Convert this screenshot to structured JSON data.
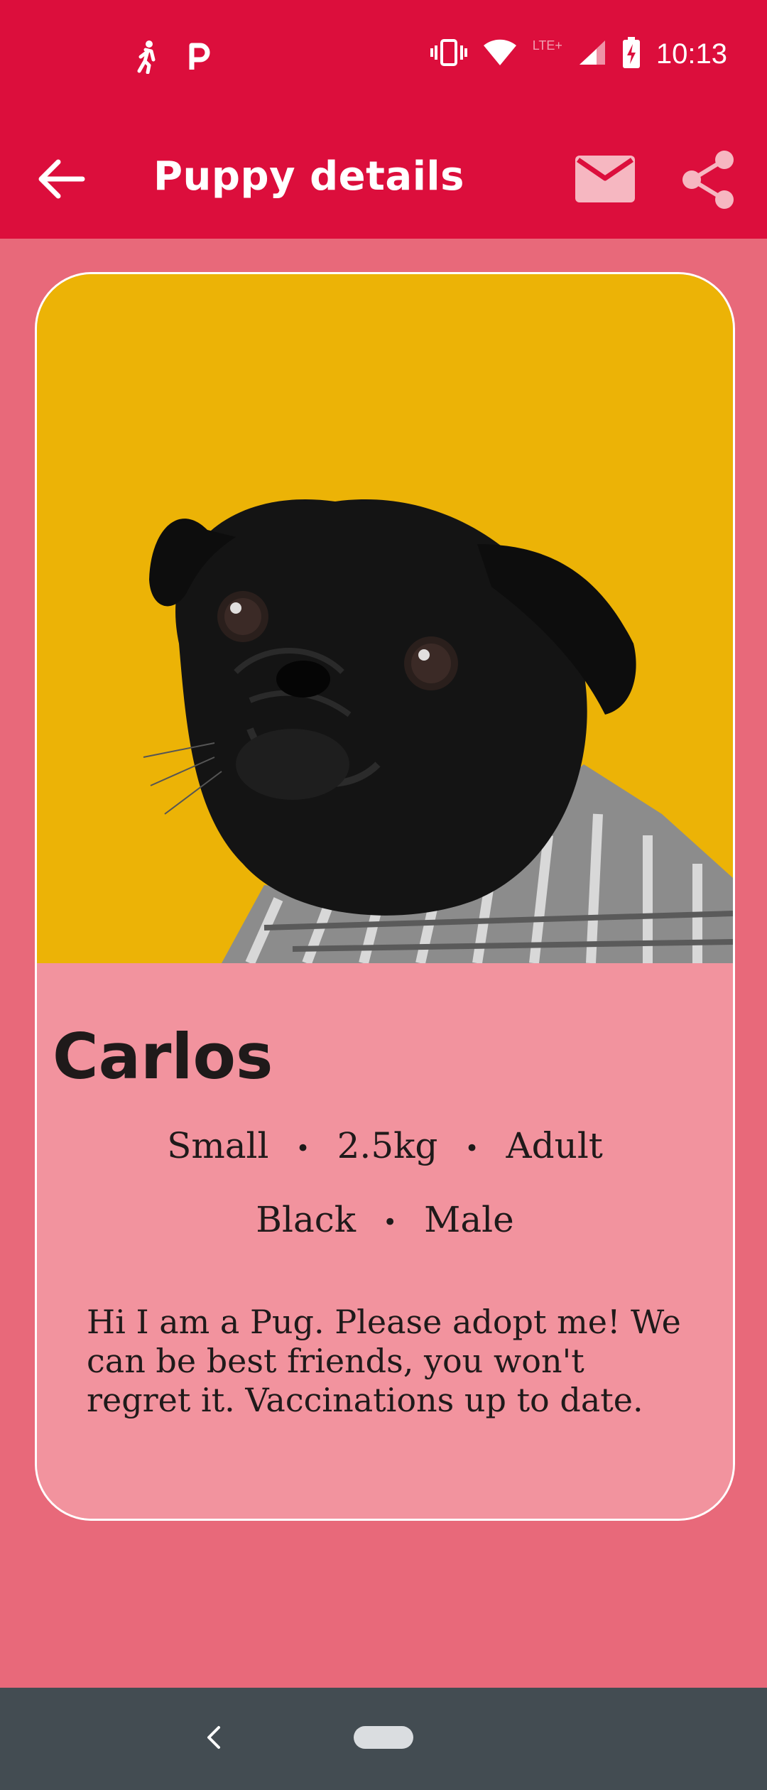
{
  "status_bar": {
    "time": "10:13",
    "network_label": "LTE+",
    "icons": [
      "walking-icon",
      "parking-icon",
      "vibrate-icon",
      "wifi-icon",
      "signal-icon",
      "battery-charging-icon"
    ]
  },
  "app_bar": {
    "title": "Puppy details",
    "actions": [
      "back-arrow-icon",
      "mail-icon",
      "share-icon"
    ]
  },
  "puppy": {
    "name": "Carlos",
    "size": "Small",
    "weight": "2.5kg",
    "age": "Adult",
    "color": "Black",
    "sex": "Male",
    "separator": "•",
    "description": "Hi I am a Pug. Please adopt me! We can be best friends, you won't regret it. Vaccinations up to date."
  },
  "nav_bar": {
    "buttons": [
      "nav-back-icon",
      "home-pill"
    ]
  },
  "colors": {
    "primary": "#DC0E3C",
    "background": "#E8697A",
    "card": "#F2939E",
    "photo_bg": "#ECB306",
    "nav_bar": "#434C52"
  }
}
